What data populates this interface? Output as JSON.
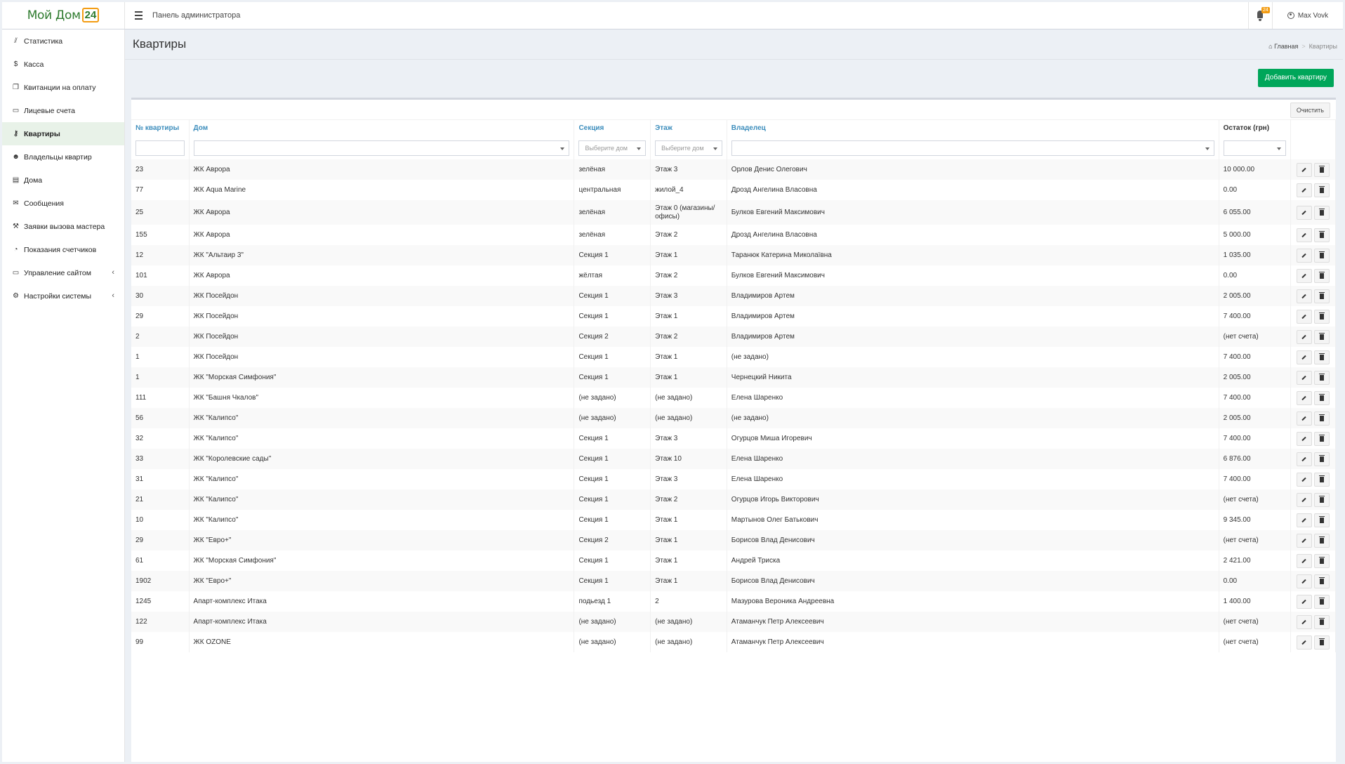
{
  "app": {
    "logo_text": "Мой Дом",
    "logo_num": "24",
    "top_title": "Панель администратора",
    "notif_count": "24",
    "user_name": "Max Vovk"
  },
  "sidebar": {
    "items": [
      {
        "label": "Статистика",
        "icon": "chart-line-icon",
        "glyph": "⫽",
        "active": false
      },
      {
        "label": "Касса",
        "icon": "dollar-icon",
        "glyph": "$",
        "active": false
      },
      {
        "label": "Квитанции на оплату",
        "icon": "copy-icon",
        "glyph": "❐",
        "active": false
      },
      {
        "label": "Лицевые счета",
        "icon": "credit-card-icon",
        "glyph": "▭",
        "active": false
      },
      {
        "label": "Квартиры",
        "icon": "key-icon",
        "glyph": "⚷",
        "active": true
      },
      {
        "label": "Владельцы квартир",
        "icon": "users-icon",
        "glyph": "☻",
        "active": false
      },
      {
        "label": "Дома",
        "icon": "building-icon",
        "glyph": "▤",
        "active": false
      },
      {
        "label": "Сообщения",
        "icon": "envelope-icon",
        "glyph": "✉",
        "active": false
      },
      {
        "label": "Заявки вызова мастера",
        "icon": "wrench-icon",
        "glyph": "⚒",
        "active": false
      },
      {
        "label": "Показания счетчиков",
        "icon": "dashboard-icon",
        "glyph": "◔",
        "active": false
      },
      {
        "label": "Управление сайтом",
        "icon": "desktop-icon",
        "glyph": "▭",
        "active": false,
        "chevron": true
      },
      {
        "label": "Настройки системы",
        "icon": "cogs-icon",
        "glyph": "⚙",
        "active": false,
        "chevron": true
      }
    ]
  },
  "page": {
    "title": "Квартиры",
    "breadcrumb_home": "Главная",
    "breadcrumb_current": "Квартиры",
    "add_button": "Добавить квартиру",
    "clear_button": "Очистить"
  },
  "table": {
    "headers": [
      "№ квартиры",
      "Дом",
      "Секция",
      "Этаж",
      "Владелец",
      "Остаток (грн)"
    ],
    "filters": {
      "section_placeholder": "Выберите дом",
      "floor_placeholder": "Выберите дом"
    },
    "rows": [
      {
        "num": "23",
        "house": "ЖК Аврора",
        "section": "зелёная",
        "floor": "Этаж 3",
        "owner": "Орлов Денис Олегович",
        "balance": "10 000.00",
        "positive": true
      },
      {
        "num": "77",
        "house": "ЖК Aqua Marine",
        "section": "центральная",
        "floor": "жилой_4",
        "owner": "Дрозд Ангелина Власовна",
        "balance": "0.00",
        "positive": false
      },
      {
        "num": "25",
        "house": "ЖК Аврора",
        "section": "зелёная",
        "floor": "Этаж 0 (магазины/ офисы)",
        "owner": "Булков Евгений Максимович",
        "balance": "6 055.00",
        "positive": true
      },
      {
        "num": "155",
        "house": "ЖК Аврора",
        "section": "зелёная",
        "floor": "Этаж 2",
        "owner": "Дрозд Ангелина Власовна",
        "balance": "5 000.00",
        "positive": true
      },
      {
        "num": "12",
        "house": "ЖК \"Альтаир 3\"",
        "section": "Секция 1",
        "floor": "Этаж 1",
        "owner": "Таранюк Катерина Миколаївна",
        "balance": "1 035.00",
        "positive": true
      },
      {
        "num": "101",
        "house": "ЖК Аврора",
        "section": "жёлтая",
        "floor": "Этаж 2",
        "owner": "Булков Евгений Максимович",
        "balance": "0.00",
        "positive": false
      },
      {
        "num": "30",
        "house": "ЖК Посейдон",
        "section": "Секция 1",
        "floor": "Этаж 3",
        "owner": "Владимиров Артем",
        "balance": "2 005.00",
        "positive": true
      },
      {
        "num": "29",
        "house": "ЖК Посейдон",
        "section": "Секция 1",
        "floor": "Этаж 1",
        "owner": "Владимиров Артем",
        "balance": "7 400.00",
        "positive": true
      },
      {
        "num": "2",
        "house": "ЖК Посейдон",
        "section": "Секция 2",
        "floor": "Этаж 2",
        "owner": "Владимиров Артем",
        "balance": "(нет счета)",
        "positive": false
      },
      {
        "num": "1",
        "house": "ЖК Посейдон",
        "section": "Секция 1",
        "floor": "Этаж 1",
        "owner": "(не задано)",
        "balance": "7 400.00",
        "positive": true
      },
      {
        "num": "1",
        "house": "ЖК \"Морская Симфония\"",
        "section": "Секция 1",
        "floor": "Этаж 1",
        "owner": "Чернецкий Никита",
        "balance": "2 005.00",
        "positive": true
      },
      {
        "num": "111",
        "house": "ЖК \"Башня Чкалов\"",
        "section": "(не задано)",
        "floor": "(не задано)",
        "owner": "Елена Шаренко",
        "balance": "7 400.00",
        "positive": true
      },
      {
        "num": "56",
        "house": "ЖК \"Калипсо\"",
        "section": "(не задано)",
        "floor": "(не задано)",
        "owner": "(не задано)",
        "balance": "2 005.00",
        "positive": true
      },
      {
        "num": "32",
        "house": "ЖК \"Калипсо\"",
        "section": "Секция 1",
        "floor": "Этаж 3",
        "owner": "Огурцов Миша Игоревич",
        "balance": "7 400.00",
        "positive": true
      },
      {
        "num": "33",
        "house": "ЖК \"Королевские сады\"",
        "section": "Секция 1",
        "floor": "Этаж 10",
        "owner": "Елена Шаренко",
        "balance": "6 876.00",
        "positive": true
      },
      {
        "num": "31",
        "house": "ЖК \"Калипсо\"",
        "section": "Секция 1",
        "floor": "Этаж 3",
        "owner": "Елена Шаренко",
        "balance": "7 400.00",
        "positive": true
      },
      {
        "num": "21",
        "house": "ЖК \"Калипсо\"",
        "section": "Секция 1",
        "floor": "Этаж 2",
        "owner": "Огурцов Игорь Викторович",
        "balance": "(нет счета)",
        "positive": false
      },
      {
        "num": "10",
        "house": "ЖК \"Калипсо\"",
        "section": "Секция 1",
        "floor": "Этаж 1",
        "owner": "Мартынов Олег Батькович",
        "balance": "9 345.00",
        "positive": true
      },
      {
        "num": "29",
        "house": "ЖК \"Евро+\"",
        "section": "Секция 2",
        "floor": "Этаж 1",
        "owner": "Борисов Влад Денисович",
        "balance": "(нет счета)",
        "positive": false
      },
      {
        "num": "61",
        "house": "ЖК \"Морская Симфония\"",
        "section": "Секция 1",
        "floor": "Этаж 1",
        "owner": "Андрей Триска",
        "balance": "2 421.00",
        "positive": true
      },
      {
        "num": "1902",
        "house": "ЖК \"Евро+\"",
        "section": "Секция 1",
        "floor": "Этаж 1",
        "owner": "Борисов Влад Денисович",
        "balance": "0.00",
        "positive": false
      },
      {
        "num": "1245",
        "house": "Апарт-комплекс Итака",
        "section": "подьезд 1",
        "floor": "2",
        "owner": "Мазурова Вероника Андреевна",
        "balance": "1 400.00",
        "positive": true
      },
      {
        "num": "122",
        "house": "Апарт-комплекс Итака",
        "section": "(не задано)",
        "floor": "(не задано)",
        "owner": "Атаманчук Петр Алексеевич",
        "balance": "(нет счета)",
        "positive": false
      },
      {
        "num": "99",
        "house": "ЖК OZONE",
        "section": "(не задано)",
        "floor": "(не задано)",
        "owner": "Атаманчук Петр Алексеевич",
        "balance": "(нет счета)",
        "positive": false
      }
    ]
  },
  "colors": {
    "accent_green": "#00a65a",
    "link_blue": "#3c8dbc",
    "logo_green": "#2d7a2d",
    "logo_orange": "#f39c12"
  }
}
